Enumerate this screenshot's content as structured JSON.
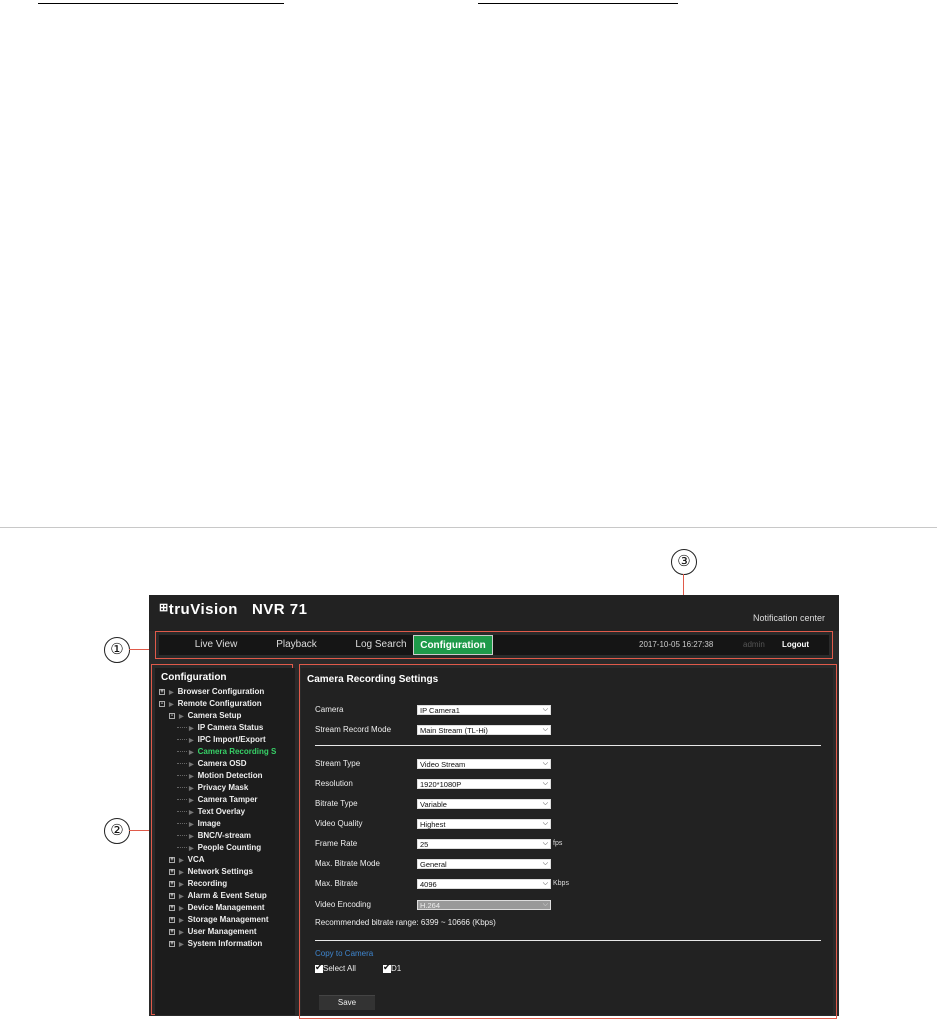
{
  "callouts": [
    "①",
    "②",
    "③"
  ],
  "app": {
    "logo": "truVision",
    "model": "NVR 71",
    "notification": "Notification center"
  },
  "nav": {
    "items": [
      "Live View",
      "Playback",
      "Log Search",
      "Configuration"
    ],
    "active": "Configuration",
    "datetime": "2017-10-05 16:27:38",
    "user": "admin",
    "logout": "Logout"
  },
  "sidebar": {
    "title": "Configuration",
    "items": [
      {
        "label": "Browser Configuration",
        "level": 0,
        "toggle": "+"
      },
      {
        "label": "Remote Configuration",
        "level": 0,
        "toggle": "-"
      },
      {
        "label": "Camera Setup",
        "level": 1,
        "toggle": "-"
      },
      {
        "label": "IP Camera Status",
        "level": 2
      },
      {
        "label": "IPC Import/Export",
        "level": 2
      },
      {
        "label": "Camera Recording S",
        "level": 2,
        "active": true
      },
      {
        "label": "Camera OSD",
        "level": 2
      },
      {
        "label": "Motion Detection",
        "level": 2
      },
      {
        "label": "Privacy Mask",
        "level": 2
      },
      {
        "label": "Camera Tamper",
        "level": 2
      },
      {
        "label": "Text Overlay",
        "level": 2
      },
      {
        "label": "Image",
        "level": 2
      },
      {
        "label": "BNC/V-stream",
        "level": 2
      },
      {
        "label": "People Counting",
        "level": 2
      },
      {
        "label": "VCA",
        "level": 1,
        "toggle": "+"
      },
      {
        "label": "Network Settings",
        "level": 1,
        "toggle": "+"
      },
      {
        "label": "Recording",
        "level": 1,
        "toggle": "+"
      },
      {
        "label": "Alarm & Event Setup",
        "level": 1,
        "toggle": "+"
      },
      {
        "label": "Device Management",
        "level": 1,
        "toggle": "+"
      },
      {
        "label": "Storage Management",
        "level": 1,
        "toggle": "+"
      },
      {
        "label": "User Management",
        "level": 1,
        "toggle": "+"
      },
      {
        "label": "System Information",
        "level": 1,
        "toggle": "+"
      }
    ]
  },
  "content": {
    "title": "Camera Recording Settings",
    "camera": {
      "label": "Camera",
      "value": "IP Camera1"
    },
    "stream_record_mode": {
      "label": "Stream Record Mode",
      "value": "Main Stream (TL-Hi)"
    },
    "stream_type": {
      "label": "Stream Type",
      "value": "Video Stream"
    },
    "resolution": {
      "label": "Resolution",
      "value": "1920*1080P"
    },
    "bitrate_type": {
      "label": "Bitrate Type",
      "value": "Variable"
    },
    "video_quality": {
      "label": "Video Quality",
      "value": "Highest"
    },
    "frame_rate": {
      "label": "Frame Rate",
      "value": "25",
      "unit": "fps"
    },
    "max_bitrate_mode": {
      "label": "Max. Bitrate Mode",
      "value": "General"
    },
    "max_bitrate": {
      "label": "Max. Bitrate",
      "value": "4096",
      "unit": "Kbps"
    },
    "video_encoding": {
      "label": "Video Encoding",
      "value": "H.264"
    },
    "recommended": "Recommended bitrate range: 6399 ~ 10666 (Kbps)",
    "copy_to_camera": "Copy to Camera",
    "select_all": "Select All",
    "d1": "D1",
    "save": "Save"
  },
  "colors": {
    "accent": "#1e9a4a",
    "active_tree": "#37d067",
    "link": "#3f86cf",
    "callout_line": "#e05a4a"
  }
}
